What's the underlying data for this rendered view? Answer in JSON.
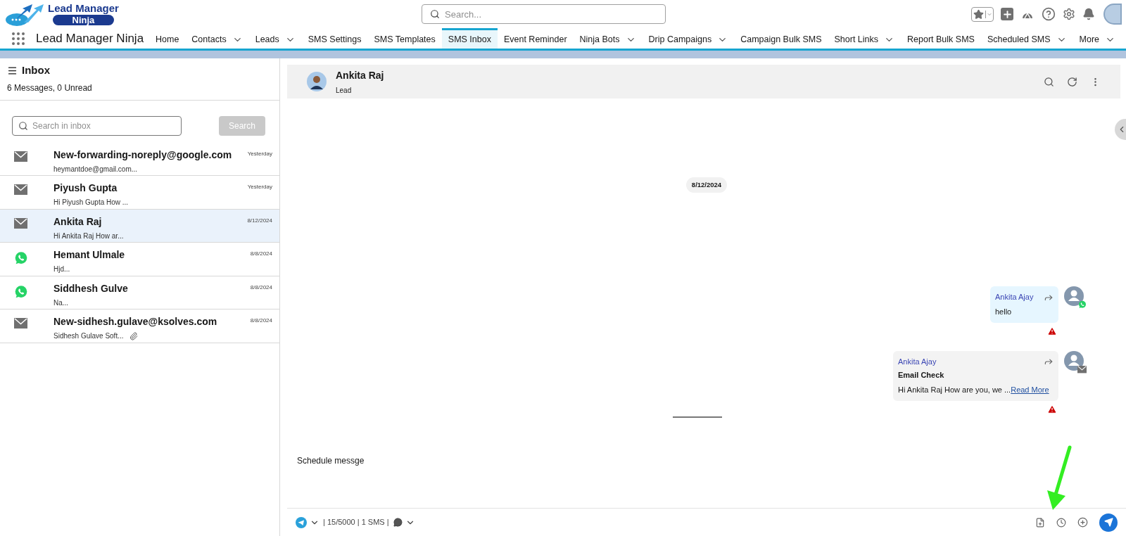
{
  "logo": {
    "line_1": "Lead Manager",
    "line_2": "Ninja"
  },
  "search": {
    "placeholder": "Search..."
  },
  "app_name": "Lead Manager Ninja",
  "nav": [
    {
      "label": "Home",
      "dropdown": false,
      "selected": false
    },
    {
      "label": "Contacts",
      "dropdown": true,
      "selected": false
    },
    {
      "label": "Leads",
      "dropdown": true,
      "selected": false
    },
    {
      "label": "SMS Settings",
      "dropdown": false,
      "selected": false
    },
    {
      "label": "SMS Templates",
      "dropdown": false,
      "selected": false
    },
    {
      "label": "SMS Inbox",
      "dropdown": false,
      "selected": true
    },
    {
      "label": "Event Reminder",
      "dropdown": false,
      "selected": false
    },
    {
      "label": "Ninja Bots",
      "dropdown": true,
      "selected": false
    },
    {
      "label": "Drip Campaigns",
      "dropdown": true,
      "selected": false
    },
    {
      "label": "Campaign Bulk SMS",
      "dropdown": false,
      "selected": false
    },
    {
      "label": "Short Links",
      "dropdown": true,
      "selected": false
    },
    {
      "label": "Report Bulk SMS",
      "dropdown": false,
      "selected": false
    },
    {
      "label": "Scheduled SMS",
      "dropdown": true,
      "selected": false
    },
    {
      "label": "More",
      "dropdown": true,
      "selected": false
    }
  ],
  "inbox": {
    "title": "Inbox",
    "summary": "6 Messages, 0 Unread",
    "search_placeholder": "Search in inbox",
    "search_button": "Search",
    "items": [
      {
        "kind": "email",
        "name": "New-forwarding-noreply@google.com",
        "preview": "heymantdoe@gmail.com...",
        "date": "Yesterday",
        "selected": false,
        "attachment": false
      },
      {
        "kind": "email",
        "name": "Piyush Gupta",
        "preview": "Hi Piyush Gupta How ...",
        "date": "Yesterday",
        "selected": false,
        "attachment": false
      },
      {
        "kind": "email",
        "name": "Ankita Raj",
        "preview": "Hi Ankita Raj How ar...",
        "date": "8/12/2024",
        "selected": true,
        "attachment": false
      },
      {
        "kind": "whatsapp",
        "name": "Hemant Ulmale",
        "preview": "Hjd...",
        "date": "8/8/2024",
        "selected": false,
        "attachment": false
      },
      {
        "kind": "whatsapp",
        "name": "Siddhesh Gulve",
        "preview": "Na...",
        "date": "8/8/2024",
        "selected": false,
        "attachment": false
      },
      {
        "kind": "email",
        "name": "New-sidhesh.gulave@ksolves.com",
        "preview": "Sidhesh Gulave Soft...",
        "date": "8/8/2024",
        "selected": false,
        "attachment": true
      }
    ]
  },
  "conversation": {
    "name": "Ankita Raj",
    "role": "Lead",
    "date_chip": "8/12/2024",
    "messages": [
      {
        "kind": "whatsapp",
        "sender": "Ankita Ajay",
        "body": "hello",
        "error": true
      },
      {
        "kind": "email",
        "sender": "Ankita Ajay",
        "subject": "Email Check",
        "body": "Hi Ankita Raj How are you, we ...",
        "link": "Read More",
        "error": true
      }
    ],
    "composer": {
      "value": "Schedule messge",
      "counter": "| 15/5000 | 1 SMS |"
    }
  }
}
